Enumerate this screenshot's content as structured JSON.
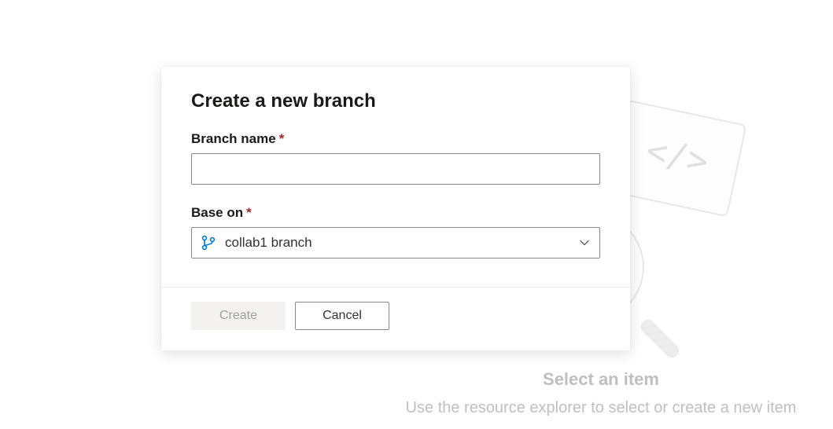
{
  "modal": {
    "title": "Create a new branch",
    "branch_name": {
      "label": "Branch name",
      "value": ""
    },
    "base_on": {
      "label": "Base on",
      "selected": "collab1 branch"
    },
    "buttons": {
      "create": "Create",
      "cancel": "Cancel"
    }
  },
  "background": {
    "heading": "Select an item",
    "subtext": "Use the resource explorer to select or create a new item"
  },
  "colors": {
    "branch_icon": "#0078d4",
    "required": "#a4262c"
  }
}
